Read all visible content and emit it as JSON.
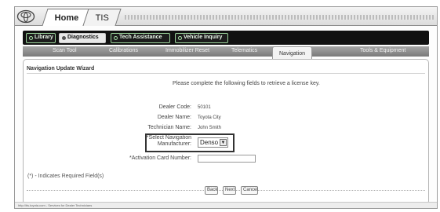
{
  "browser_tabs": {
    "home": "Home",
    "tis": "TIS"
  },
  "main_nav": [
    {
      "label": "Library"
    },
    {
      "label": "Diagnostics"
    },
    {
      "label": "Tech Assistance"
    },
    {
      "label": "Vehicle Inquiry"
    }
  ],
  "sub_nav": [
    {
      "label": "Scan Tool"
    },
    {
      "label": "Calibrations"
    },
    {
      "label": "Immobilizer Reset"
    },
    {
      "label": "Telematics"
    },
    {
      "label": "Navigation"
    },
    {
      "label": "Tools & Equipment"
    }
  ],
  "wizard": {
    "title": "Navigation Update Wizard",
    "instructions": "Please complete the following fields to retrieve a license key.",
    "dealer_code_label": "Dealer Code:",
    "dealer_code_value": "50101",
    "dealer_name_label": "Dealer Name:",
    "dealer_name_value": "Toyota City",
    "technician_name_label": "Technician Name:",
    "technician_name_value": "John Smith",
    "manufacturer_label_1": "*Select Navigation",
    "manufacturer_label_2": "Manufacturer:",
    "manufacturer_value": "Denso",
    "activation_label": "*Activation Card Number:",
    "activation_value": "",
    "required_note": "(*) - Indicates Required Field(s)",
    "buttons": {
      "back": "Back",
      "next": "Next",
      "cancel": "Cancel"
    }
  },
  "status_bar": "http://tis.toyota.com - Services for Dealer Technicians"
}
